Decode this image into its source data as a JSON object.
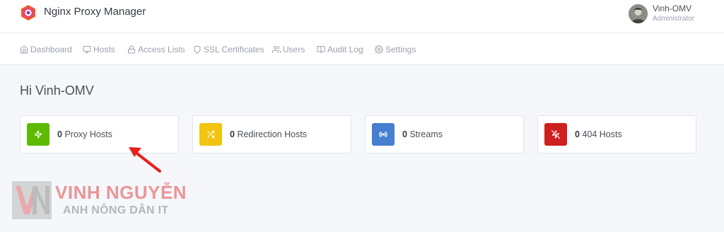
{
  "app": {
    "title": "Nginx Proxy Manager",
    "logo_icon": "nginx-proxy-manager-logo"
  },
  "user": {
    "name": "Vinh-OMV",
    "role": "Administrator"
  },
  "nav": {
    "items": [
      {
        "label": "Dashboard",
        "icon": "home-icon"
      },
      {
        "label": "Hosts",
        "icon": "monitor-icon"
      },
      {
        "label": "Access Lists",
        "icon": "lock-icon"
      },
      {
        "label": "SSL Certificates",
        "icon": "shield-icon"
      },
      {
        "label": "Users",
        "icon": "users-icon"
      },
      {
        "label": "Audit Log",
        "icon": "book-icon"
      },
      {
        "label": "Settings",
        "icon": "gear-icon"
      }
    ]
  },
  "greeting": "Hi Vinh-OMV",
  "stats": [
    {
      "count": "0",
      "label": "Proxy Hosts",
      "icon": "zap-icon",
      "color": "#5eba00"
    },
    {
      "count": "0",
      "label": "Redirection Hosts",
      "icon": "shuffle-icon",
      "color": "#f1c40f"
    },
    {
      "count": "0",
      "label": "Streams",
      "icon": "radio-icon",
      "color": "#467fcf"
    },
    {
      "count": "0",
      "label": "404 Hosts",
      "icon": "zap-off-icon",
      "color": "#cd201f"
    }
  ],
  "annotation": {
    "icon": "red-arrow-icon",
    "color": "#e8201a"
  },
  "watermark": {
    "name": "VINH NGUYỄN",
    "tagline": "ANH NÔNG DÂN IT"
  }
}
